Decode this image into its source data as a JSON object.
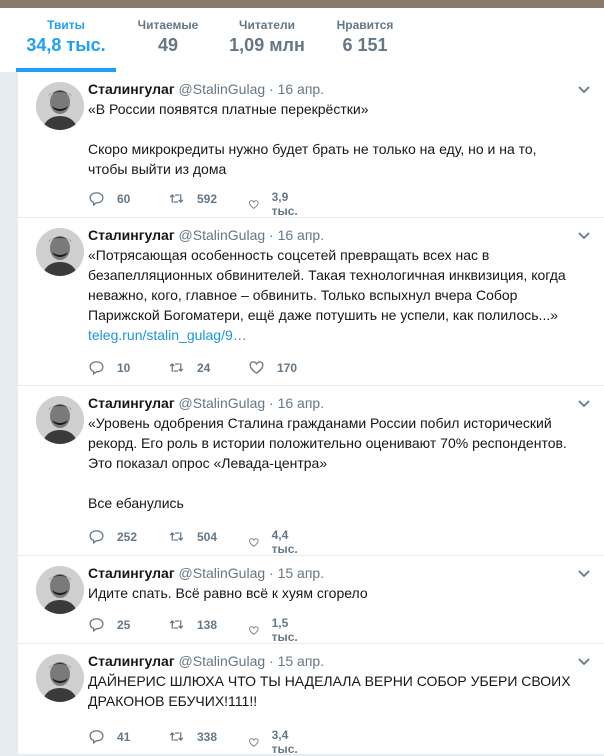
{
  "stats": [
    {
      "label": "Твиты",
      "value": "34,8 тыс.",
      "active": true
    },
    {
      "label": "Читаемые",
      "value": "49"
    },
    {
      "label": "Читатели",
      "value": "1,09 млн"
    },
    {
      "label": "Нравится",
      "value": "6 151"
    }
  ],
  "tweets": [
    {
      "name": "Сталингулаг",
      "handle": "@StalinGulag",
      "date": "16 апр.",
      "text": "«В России появятся платные перекрёстки»\n\nСкоро микрокредиты нужно будет брать не только на еду, но и на то, чтобы выйти из дома",
      "link": "",
      "replies": "60",
      "retweets": "592",
      "likes": "3,9 тыс."
    },
    {
      "name": "Сталингулаг",
      "handle": "@StalinGulag",
      "date": "16 апр.",
      "text": "«Потрясающая особенность соцсетей превращать всех нас в безапелляционных обвинителей. Такая технологичная инквизиция, когда неважно, кого, главное – обвинить. Только вспыхнул вчера Собор Парижской Богоматери, ещё даже потушить не успели, как полилось...»",
      "link": "teleg.run/stalin_gulag/9…",
      "replies": "10",
      "retweets": "24",
      "likes": "170"
    },
    {
      "name": "Сталингулаг",
      "handle": "@StalinGulag",
      "date": "16 апр.",
      "text": "«Уровень одобрения Сталина гражданами России побил исторический рекорд. Его роль в истории положительно оценивают 70% респондентов. Это показал опрос «Левада-центра»\n\nВсе ебанулись",
      "link": "",
      "replies": "252",
      "retweets": "504",
      "likes": "4,4 тыс."
    },
    {
      "name": "Сталингулаг",
      "handle": "@StalinGulag",
      "date": "15 апр.",
      "text": "Идите спать. Всё равно всё к хуям сгорело",
      "link": "",
      "replies": "25",
      "retweets": "138",
      "likes": "1,5 тыс."
    },
    {
      "name": "Сталингулаг",
      "handle": "@StalinGulag",
      "date": "15 апр.",
      "text": "ДАЙНЕРИС ШЛЮХА ЧТО ТЫ НАДЕЛАЛА ВЕРНИ СОБОР УБЕРИ СВОИХ ДРАКОНОВ ЕБУЧИХ!111!!",
      "link": "",
      "replies": "41",
      "retweets": "338",
      "likes": "3,4 тыс."
    }
  ],
  "colors": {
    "accent": "#1da1f2",
    "muted": "#657786",
    "link": "#1b95e0"
  },
  "icons": {
    "reply": "reply-icon",
    "retweet": "retweet-icon",
    "like": "heart-icon",
    "menu": "chevron-down-icon"
  }
}
